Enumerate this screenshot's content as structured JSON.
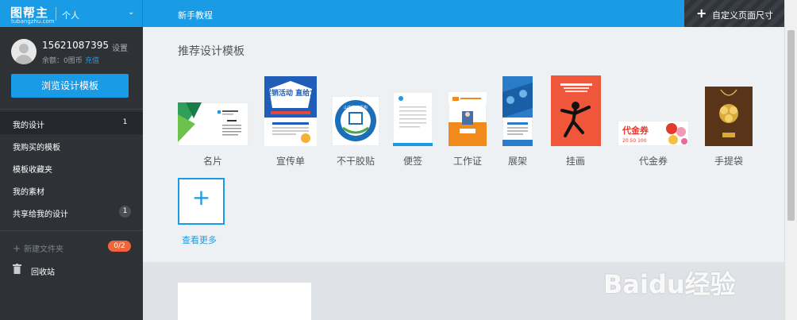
{
  "header": {
    "logo_text": "图帮主",
    "logo_sub": "tubangzhu.com",
    "mode": "个人",
    "tutorial": "新手教程",
    "custom_size": "自定义页面尺寸"
  },
  "user": {
    "phone": "15621087395",
    "settings": "设置",
    "balance": "余额：0图币",
    "recharge": "充值",
    "browse_button": "浏览设计模板"
  },
  "nav": [
    {
      "label": "我的设计",
      "count": "1",
      "active": true
    },
    {
      "label": "我购买的模板",
      "count": ""
    },
    {
      "label": "模板收藏夹",
      "count": ""
    },
    {
      "label": "我的素材",
      "count": ""
    },
    {
      "label": "共享给我的设计",
      "count": "1"
    }
  ],
  "folders": {
    "new_folder": "新建文件夹",
    "badge": "0/2",
    "trash": "回收站"
  },
  "main": {
    "section_title": "推荐设计模板",
    "templates": [
      {
        "label": "名片"
      },
      {
        "label": "宣传单",
        "headline": "促销活动 直给力"
      },
      {
        "label": "不干胶贴",
        "ring_text": "山东某某机构"
      },
      {
        "label": "便签"
      },
      {
        "label": "工作证"
      },
      {
        "label": "展架"
      },
      {
        "label": "挂画"
      },
      {
        "label": "代金券",
        "coupon_text": "代金券",
        "coupon_amounts": "20  50  100"
      },
      {
        "label": "手提袋"
      }
    ],
    "more_label": "查看更多"
  },
  "watermark": "Baidu经验",
  "colors": {
    "accent": "#1a9be6",
    "sidebar": "#2e3237",
    "badge": "#f0643c"
  }
}
